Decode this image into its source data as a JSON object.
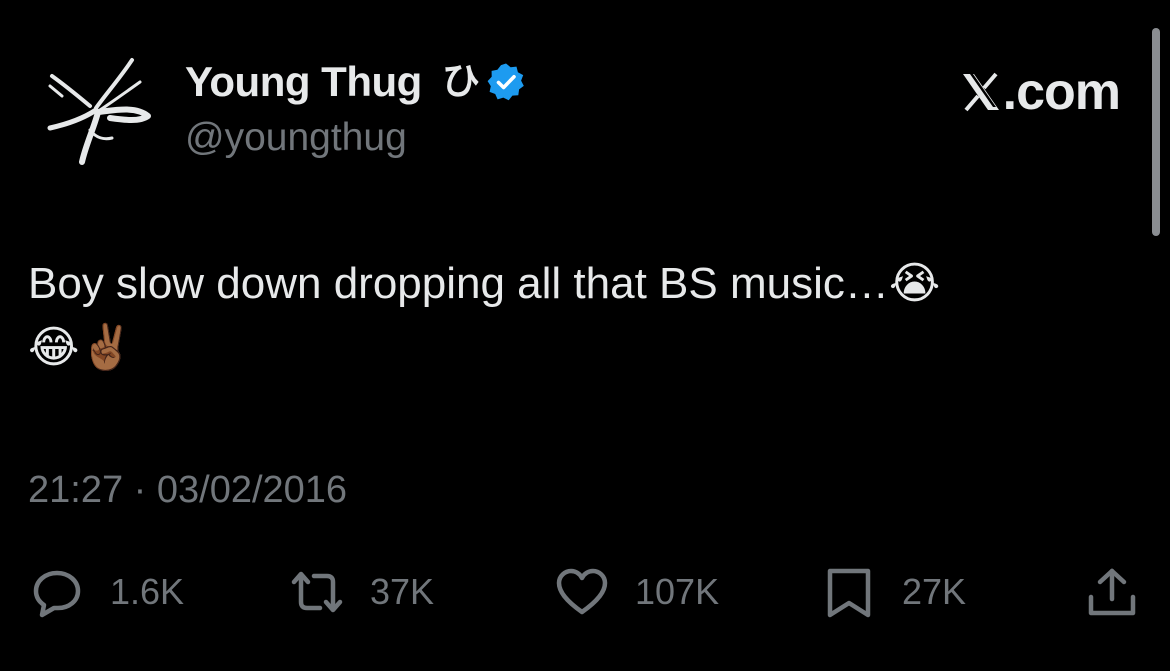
{
  "author": {
    "display_name": "Young Thug",
    "name_mark": "ひ",
    "handle": "@youngthug",
    "verified": true,
    "verified_color": "#1d9bf0"
  },
  "brand": {
    "label": ".com",
    "icon": "x-logo-icon"
  },
  "tweet": {
    "text": "Boy slow down dropping all that BS music…😭\n😂✌🏾",
    "timestamp": "21:27 · 03/02/2016"
  },
  "actions": [
    {
      "icon": "reply-icon",
      "count": "1.6K"
    },
    {
      "icon": "repost-icon",
      "count": "37K"
    },
    {
      "icon": "like-icon",
      "count": "107K"
    },
    {
      "icon": "bookmark-icon",
      "count": "27K"
    },
    {
      "icon": "share-icon",
      "count": ""
    }
  ],
  "colors": {
    "background": "#000000",
    "primary_text": "#e7e9ea",
    "secondary_text": "#71767b",
    "accent": "#1d9bf0"
  }
}
